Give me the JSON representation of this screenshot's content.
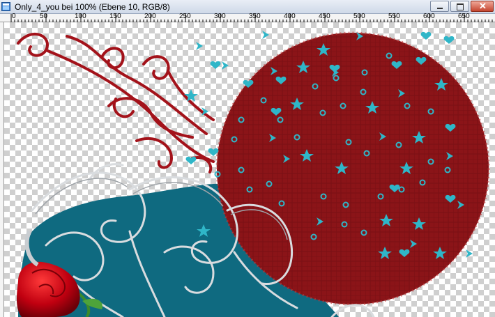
{
  "window": {
    "title": "Only_4_you bei 100% (Ebene 10, RGB/8)",
    "buttons": [
      "minimize",
      "maximize",
      "close"
    ],
    "icon": "psp-document-icon"
  },
  "ruler": {
    "labels": [
      "0",
      "50",
      "100",
      "150",
      "200",
      "250",
      "300",
      "350",
      "400",
      "450",
      "500",
      "550",
      "600",
      "650"
    ]
  },
  "canvas": {
    "background": "transparency-checkerboard",
    "artwork": "red circle with teal stars, hearts and dots; dark red swirls; silver swirl ornaments; teal paint blob; red rose",
    "colors": {
      "red_circle": "#8b1418",
      "teal": "#0f6a80",
      "accent_teal": "#2fb6c8",
      "silver": "#cfd3d6",
      "rose": "#c80010"
    }
  }
}
